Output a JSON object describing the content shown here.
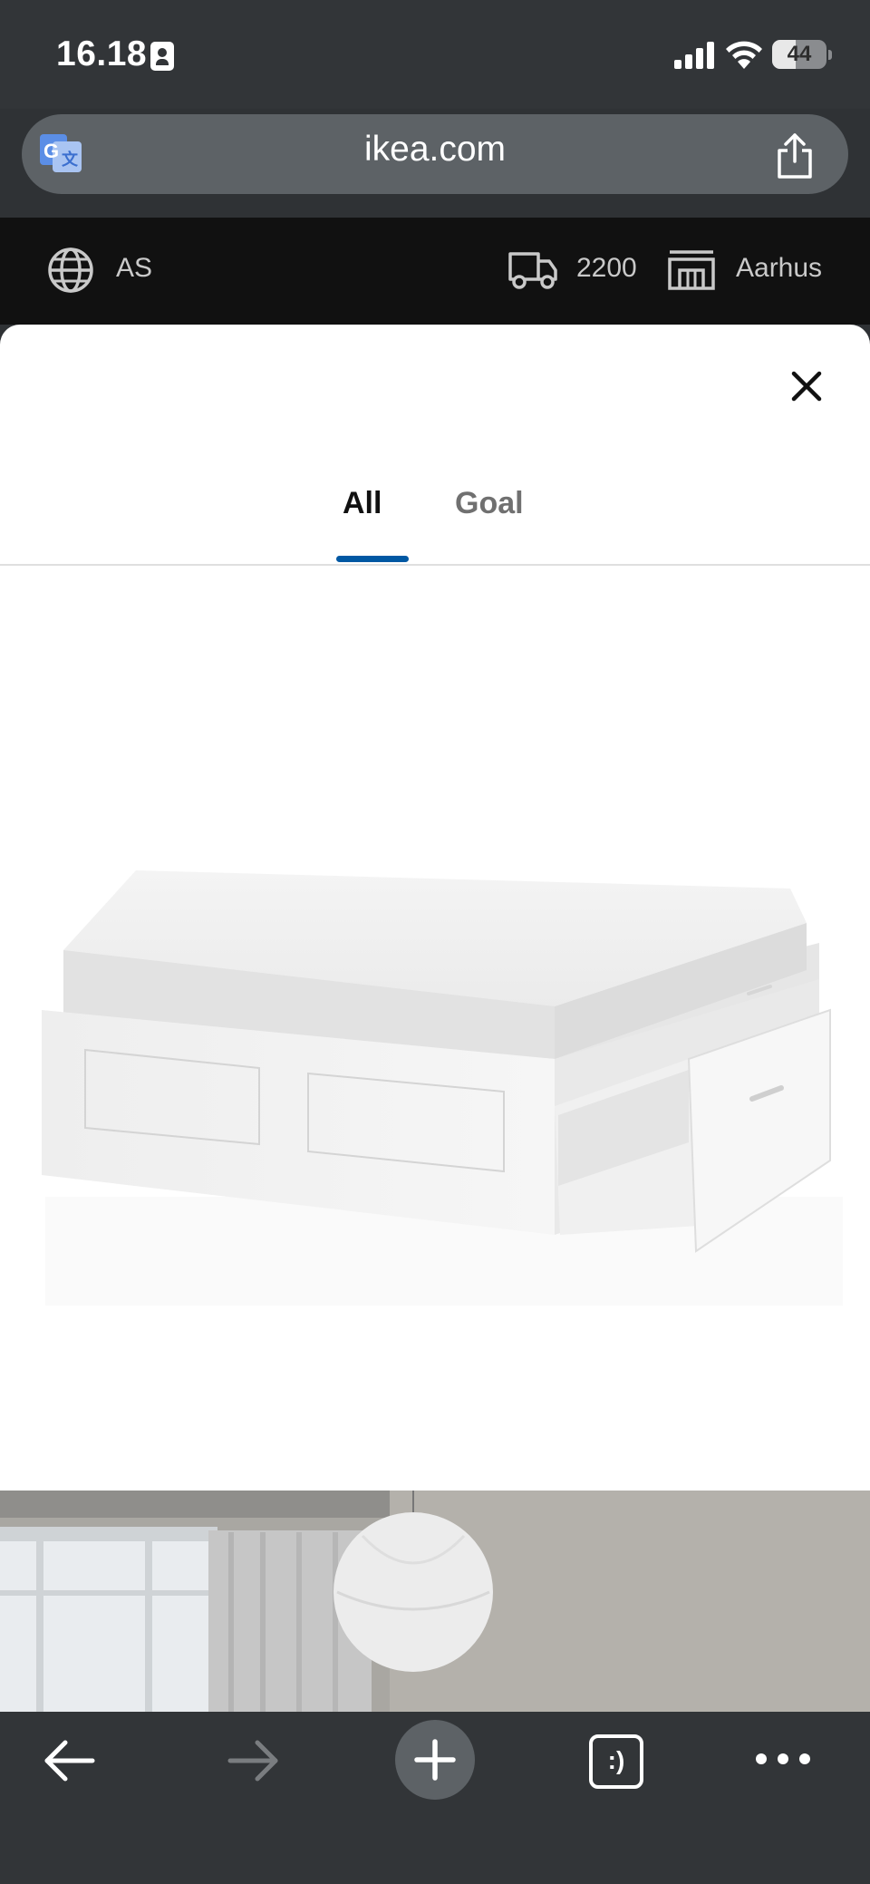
{
  "status_bar": {
    "time": "16.18",
    "battery_level": "44",
    "battery_fraction": 0.44
  },
  "browser": {
    "url": "ikea.com"
  },
  "ikea_header": {
    "language": "AS",
    "postal_code": "2200",
    "store": "Aarhus"
  },
  "gallery": {
    "tabs": [
      {
        "label": "All",
        "active": true
      },
      {
        "label": "Goal",
        "active": false
      }
    ],
    "accent_color": "#0058a3"
  },
  "toolbar": {
    "tabs_label": ":)"
  },
  "icons": [
    "contact-card-icon",
    "signal-icon",
    "wifi-icon",
    "translate-icon",
    "share-icon",
    "globe-icon",
    "truck-icon",
    "store-icon",
    "close-icon",
    "back-arrow-icon",
    "forward-arrow-icon",
    "plus-icon",
    "more-icon"
  ]
}
